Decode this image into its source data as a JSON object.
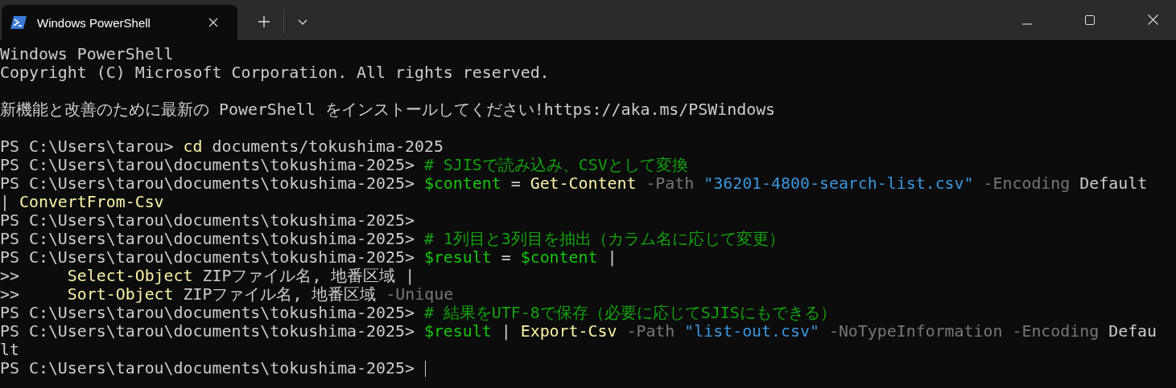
{
  "window": {
    "tab_title": "Windows PowerShell"
  },
  "terminal": {
    "lines": [
      {
        "kind": "text",
        "segments": [
          {
            "kind": "plain",
            "text": "Windows PowerShell"
          }
        ]
      },
      {
        "kind": "text",
        "segments": [
          {
            "kind": "plain",
            "text": "Copyright (C) Microsoft Corporation. All rights reserved."
          }
        ]
      },
      {
        "kind": "blank"
      },
      {
        "kind": "text",
        "segments": [
          {
            "kind": "plain",
            "text": "新機能と改善のために最新の PowerShell をインストールしてください!https://aka.ms/PSWindows"
          }
        ]
      },
      {
        "kind": "blank"
      },
      {
        "kind": "text",
        "segments": [
          {
            "kind": "plain",
            "text": "PS C:\\Users\\tarou> "
          },
          {
            "kind": "command",
            "text": "cd"
          },
          {
            "kind": "plain",
            "text": " documents/tokushima-2025"
          }
        ]
      },
      {
        "kind": "text",
        "segments": [
          {
            "kind": "plain",
            "text": "PS C:\\Users\\tarou\\documents\\tokushima-2025> "
          },
          {
            "kind": "comment",
            "text": "# SJISで読み込み、CSVとして変換"
          }
        ]
      },
      {
        "kind": "text",
        "segments": [
          {
            "kind": "plain",
            "text": "PS C:\\Users\\tarou\\documents\\tokushima-2025> "
          },
          {
            "kind": "variable",
            "text": "$content"
          },
          {
            "kind": "plain",
            "text": " = "
          },
          {
            "kind": "command",
            "text": "Get-Content"
          },
          {
            "kind": "param",
            "text": " -Path "
          },
          {
            "kind": "string",
            "text": "\"36201-4800-search-list.csv\""
          },
          {
            "kind": "param",
            "text": " -Encoding"
          },
          {
            "kind": "plain",
            "text": " Default"
          }
        ]
      },
      {
        "kind": "text",
        "segments": [
          {
            "kind": "plain",
            "text": "| "
          },
          {
            "kind": "command",
            "text": "ConvertFrom-Csv"
          }
        ]
      },
      {
        "kind": "text",
        "segments": [
          {
            "kind": "plain",
            "text": "PS C:\\Users\\tarou\\documents\\tokushima-2025>"
          }
        ]
      },
      {
        "kind": "text",
        "segments": [
          {
            "kind": "plain",
            "text": "PS C:\\Users\\tarou\\documents\\tokushima-2025> "
          },
          {
            "kind": "comment",
            "text": "# 1列目と3列目を抽出（カラム名に応じて変更）"
          }
        ]
      },
      {
        "kind": "text",
        "segments": [
          {
            "kind": "plain",
            "text": "PS C:\\Users\\tarou\\documents\\tokushima-2025> "
          },
          {
            "kind": "variable",
            "text": "$result"
          },
          {
            "kind": "plain",
            "text": " = "
          },
          {
            "kind": "variable",
            "text": "$content"
          },
          {
            "kind": "plain",
            "text": " |"
          }
        ]
      },
      {
        "kind": "text",
        "segments": [
          {
            "kind": "plain",
            "text": ">>     "
          },
          {
            "kind": "command",
            "text": "Select-Object"
          },
          {
            "kind": "plain",
            "text": " ZIPファイル名, 地番区域 |"
          }
        ]
      },
      {
        "kind": "text",
        "segments": [
          {
            "kind": "plain",
            "text": ">>     "
          },
          {
            "kind": "command",
            "text": "Sort-Object"
          },
          {
            "kind": "plain",
            "text": " ZIPファイル名, 地番区域"
          },
          {
            "kind": "param",
            "text": " -Unique"
          }
        ]
      },
      {
        "kind": "text",
        "segments": [
          {
            "kind": "plain",
            "text": "PS C:\\Users\\tarou\\documents\\tokushima-2025> "
          },
          {
            "kind": "comment",
            "text": "# 結果をUTF-8で保存（必要に応じてSJISにもできる）"
          }
        ]
      },
      {
        "kind": "text",
        "segments": [
          {
            "kind": "plain",
            "text": "PS C:\\Users\\tarou\\documents\\tokushima-2025> "
          },
          {
            "kind": "variable",
            "text": "$result"
          },
          {
            "kind": "plain",
            "text": " | "
          },
          {
            "kind": "command",
            "text": "Export-Csv"
          },
          {
            "kind": "param",
            "text": " -Path "
          },
          {
            "kind": "string",
            "text": "\"list-out.csv\""
          },
          {
            "kind": "param",
            "text": " -NoTypeInformation -Encoding"
          },
          {
            "kind": "plain",
            "text": " Defau"
          }
        ]
      },
      {
        "kind": "text",
        "segments": [
          {
            "kind": "plain",
            "text": "lt"
          }
        ]
      },
      {
        "kind": "text",
        "cursor": true,
        "segments": [
          {
            "kind": "plain",
            "text": "PS C:\\Users\\tarou\\documents\\tokushima-2025> "
          }
        ]
      }
    ]
  }
}
